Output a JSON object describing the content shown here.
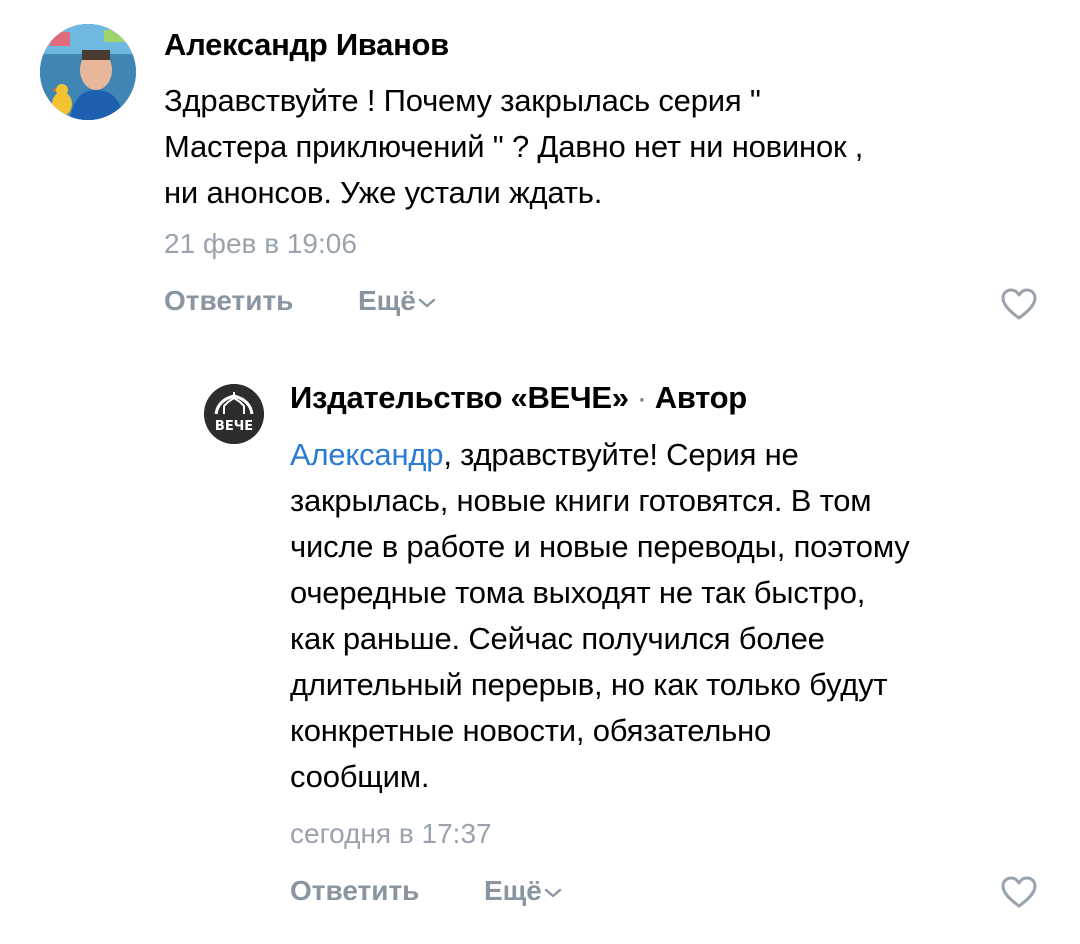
{
  "comments": [
    {
      "author": "Александр Иванов",
      "text_lines": [
        "Здравствуйте ! Почему закрылась серия \"",
        "Мастера приключений \" ? Давно нет ни новинок ,",
        "ни анонсов. Уже устали ждать."
      ],
      "time": "21 фев в 19:06",
      "reply_label": "Ответить",
      "more_label": "Ещё"
    },
    {
      "author": "Издательство «ВЕЧЕ»",
      "separator": "·",
      "author_badge": "Автор",
      "avatar_text": "ВЕЧЕ",
      "mention": "Александр",
      "text_lines": [
        ", здравствуйте! Серия не",
        "закрылась, новые книги готовятся. В том",
        "числе в работе и новые переводы, поэтому",
        "очередные тома выходят не так быстро,",
        "как раньше. Сейчас получился более",
        "длительный перерыв, но как только будут",
        "конкретные новости, обязательно",
        "сообщим."
      ],
      "time": "сегодня в 17:37",
      "reply_label": "Ответить",
      "more_label": "Ещё"
    }
  ],
  "icons": {
    "like": "heart-outline-icon",
    "more": "chevron-down-icon"
  },
  "colors": {
    "mention": "#2a7bd6",
    "meta": "#9aa3ad",
    "action": "#8a95a2"
  }
}
